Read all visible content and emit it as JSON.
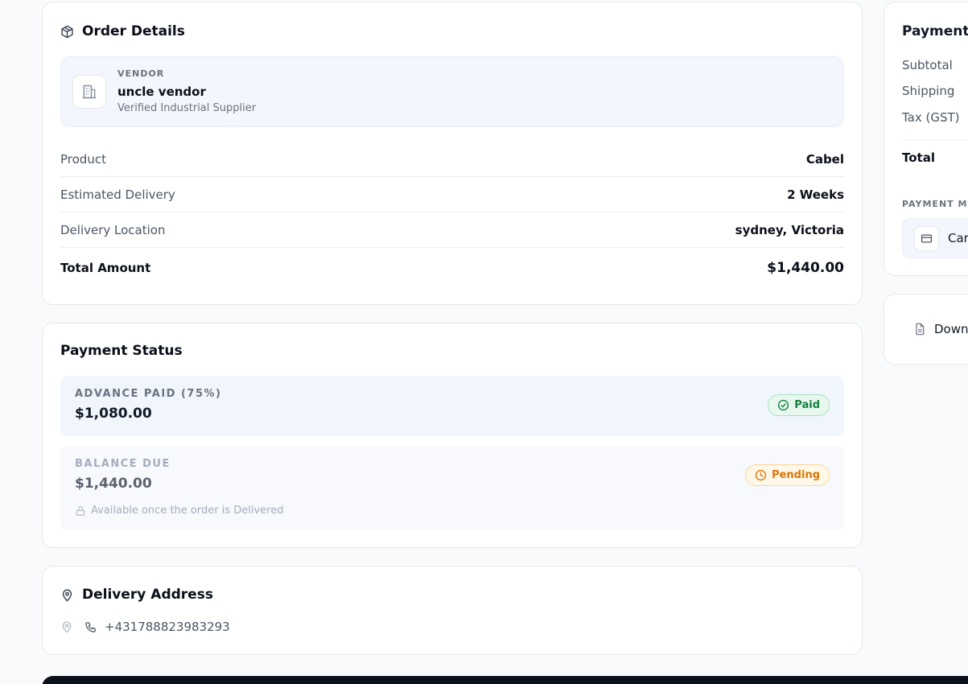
{
  "order": {
    "title": "Order Details",
    "vendor": {
      "kicker": "VENDOR",
      "name": "uncle vendor",
      "subtitle": "Verified Industrial Supplier"
    },
    "rows": [
      {
        "label": "Product",
        "value": "Cabel"
      },
      {
        "label": "Estimated Delivery",
        "value": "2 Weeks"
      },
      {
        "label": "Delivery Location",
        "value": "sydney, Victoria"
      }
    ],
    "total_label": "Total Amount",
    "total_value": "$1,440.00"
  },
  "payment_status": {
    "title": "Payment Status",
    "advance": {
      "label": "ADVANCE PAID (75%)",
      "amount": "$1,080.00",
      "badge": "Paid"
    },
    "balance": {
      "label": "BALANCE DUE",
      "amount": "$1,440.00",
      "badge": "Pending",
      "note": "Available once the order is Delivered"
    }
  },
  "delivery_address": {
    "title": "Delivery Address",
    "phone": "+431788823983293"
  },
  "summary": {
    "title": "Payment",
    "subtotal_label": "Subtotal",
    "shipping_label": "Shipping",
    "tax_label": "Tax (GST)",
    "total_label": "Total",
    "method_kicker": "PAYMENT MET",
    "method_label": "Car"
  },
  "download": {
    "label": "Down"
  },
  "colors": {
    "paid": "#15803d",
    "pending": "#d97706",
    "accent_bg": "#f3f6fc"
  }
}
